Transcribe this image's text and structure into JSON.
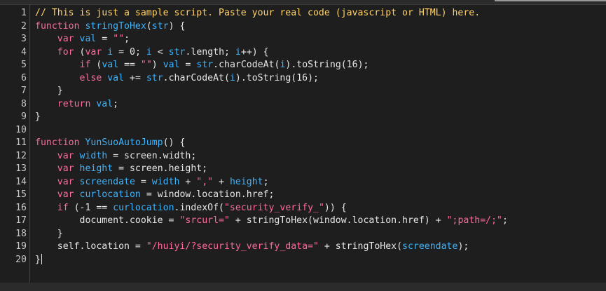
{
  "editor": {
    "lines": [
      {
        "n": "1",
        "tokens": [
          {
            "t": "cmt",
            "v": "// This is just a sample script. Paste your real code (javascript or HTML) here."
          }
        ]
      },
      {
        "n": "2",
        "tokens": [
          {
            "t": "kw",
            "v": "function "
          },
          {
            "t": "fn",
            "v": "stringToHex"
          },
          {
            "t": "plain",
            "v": "("
          },
          {
            "t": "var",
            "v": "str"
          },
          {
            "t": "plain",
            "v": ") {"
          }
        ]
      },
      {
        "n": "3",
        "tokens": [
          {
            "t": "plain",
            "v": "    "
          },
          {
            "t": "kw",
            "v": "var "
          },
          {
            "t": "var",
            "v": "val"
          },
          {
            "t": "plain",
            "v": " = "
          },
          {
            "t": "str",
            "v": "\"\""
          },
          {
            "t": "plain",
            "v": ";"
          }
        ]
      },
      {
        "n": "4",
        "tokens": [
          {
            "t": "plain",
            "v": "    "
          },
          {
            "t": "kw",
            "v": "for "
          },
          {
            "t": "plain",
            "v": "("
          },
          {
            "t": "kw",
            "v": "var "
          },
          {
            "t": "var",
            "v": "i"
          },
          {
            "t": "plain",
            "v": " = 0; "
          },
          {
            "t": "var",
            "v": "i"
          },
          {
            "t": "plain",
            "v": " < "
          },
          {
            "t": "var",
            "v": "str"
          },
          {
            "t": "plain",
            "v": ".length; "
          },
          {
            "t": "var",
            "v": "i"
          },
          {
            "t": "plain",
            "v": "++) {"
          }
        ]
      },
      {
        "n": "5",
        "tokens": [
          {
            "t": "plain",
            "v": "        "
          },
          {
            "t": "kw",
            "v": "if "
          },
          {
            "t": "plain",
            "v": "("
          },
          {
            "t": "var",
            "v": "val"
          },
          {
            "t": "plain",
            "v": " == "
          },
          {
            "t": "str",
            "v": "\"\""
          },
          {
            "t": "plain",
            "v": ") "
          },
          {
            "t": "var",
            "v": "val"
          },
          {
            "t": "plain",
            "v": " = "
          },
          {
            "t": "var",
            "v": "str"
          },
          {
            "t": "plain",
            "v": ".charCodeAt("
          },
          {
            "t": "var",
            "v": "i"
          },
          {
            "t": "plain",
            "v": ").toString(16);"
          }
        ]
      },
      {
        "n": "6",
        "tokens": [
          {
            "t": "plain",
            "v": "        "
          },
          {
            "t": "kw",
            "v": "else "
          },
          {
            "t": "var",
            "v": "val"
          },
          {
            "t": "plain",
            "v": " += "
          },
          {
            "t": "var",
            "v": "str"
          },
          {
            "t": "plain",
            "v": ".charCodeAt("
          },
          {
            "t": "var",
            "v": "i"
          },
          {
            "t": "plain",
            "v": ").toString(16);"
          }
        ]
      },
      {
        "n": "7",
        "tokens": [
          {
            "t": "plain",
            "v": "    }"
          }
        ]
      },
      {
        "n": "8",
        "tokens": [
          {
            "t": "plain",
            "v": "    "
          },
          {
            "t": "kw",
            "v": "return "
          },
          {
            "t": "var",
            "v": "val"
          },
          {
            "t": "plain",
            "v": ";"
          }
        ]
      },
      {
        "n": "9",
        "tokens": [
          {
            "t": "plain",
            "v": "}"
          }
        ]
      },
      {
        "n": "10",
        "tokens": []
      },
      {
        "n": "11",
        "tokens": [
          {
            "t": "kw",
            "v": "function "
          },
          {
            "t": "fn",
            "v": "YunSuoAutoJump"
          },
          {
            "t": "plain",
            "v": "() {"
          }
        ]
      },
      {
        "n": "12",
        "tokens": [
          {
            "t": "plain",
            "v": "    "
          },
          {
            "t": "kw",
            "v": "var "
          },
          {
            "t": "var",
            "v": "width"
          },
          {
            "t": "plain",
            "v": " = screen.width;"
          }
        ]
      },
      {
        "n": "13",
        "tokens": [
          {
            "t": "plain",
            "v": "    "
          },
          {
            "t": "kw",
            "v": "var "
          },
          {
            "t": "var",
            "v": "height"
          },
          {
            "t": "plain",
            "v": " = screen.height;"
          }
        ]
      },
      {
        "n": "14",
        "tokens": [
          {
            "t": "plain",
            "v": "    "
          },
          {
            "t": "kw",
            "v": "var "
          },
          {
            "t": "var",
            "v": "screendate"
          },
          {
            "t": "plain",
            "v": " = "
          },
          {
            "t": "var",
            "v": "width"
          },
          {
            "t": "plain",
            "v": " + "
          },
          {
            "t": "str",
            "v": "\",\""
          },
          {
            "t": "plain",
            "v": " + "
          },
          {
            "t": "var",
            "v": "height"
          },
          {
            "t": "plain",
            "v": ";"
          }
        ]
      },
      {
        "n": "15",
        "tokens": [
          {
            "t": "plain",
            "v": "    "
          },
          {
            "t": "kw",
            "v": "var "
          },
          {
            "t": "var",
            "v": "curlocation"
          },
          {
            "t": "plain",
            "v": " = window.location.href;"
          }
        ]
      },
      {
        "n": "16",
        "tokens": [
          {
            "t": "plain",
            "v": "    "
          },
          {
            "t": "kw",
            "v": "if "
          },
          {
            "t": "plain",
            "v": "(-1 == "
          },
          {
            "t": "var",
            "v": "curlocation"
          },
          {
            "t": "plain",
            "v": ".indexOf("
          },
          {
            "t": "str",
            "v": "\"security_verify_\""
          },
          {
            "t": "plain",
            "v": ")) {"
          }
        ]
      },
      {
        "n": "17",
        "tokens": [
          {
            "t": "plain",
            "v": "        document.cookie = "
          },
          {
            "t": "str",
            "v": "\"srcurl=\""
          },
          {
            "t": "plain",
            "v": " + stringToHex(window.location.href) + "
          },
          {
            "t": "str",
            "v": "\";path=/;\""
          },
          {
            "t": "plain",
            "v": ";"
          }
        ]
      },
      {
        "n": "18",
        "tokens": [
          {
            "t": "plain",
            "v": "    }"
          }
        ]
      },
      {
        "n": "19",
        "tokens": [
          {
            "t": "plain",
            "v": "    self.location = "
          },
          {
            "t": "str",
            "v": "\"/huiyi/?security_verify_data=\""
          },
          {
            "t": "plain",
            "v": " + stringToHex("
          },
          {
            "t": "var",
            "v": "screendate"
          },
          {
            "t": "plain",
            "v": ");"
          }
        ]
      },
      {
        "n": "20",
        "tokens": [
          {
            "t": "plain",
            "v": "}"
          }
        ]
      }
    ],
    "active_line": "20",
    "fold_markers": [
      "2",
      "4",
      "9",
      "11",
      "16",
      "18",
      "20"
    ]
  },
  "colors": {
    "background": "#1e1e1e",
    "keyword": "#ff6a9a",
    "identifier": "#3cb4ff",
    "string": "#ff6a9a",
    "comment": "#ffd26a",
    "text": "#e6e6e6"
  }
}
